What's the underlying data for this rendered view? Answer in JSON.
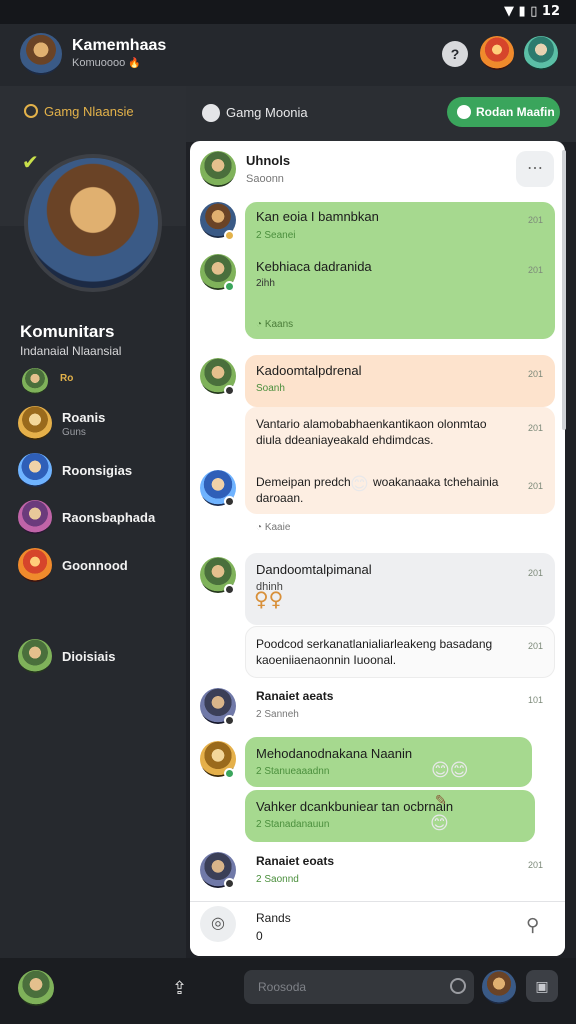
{
  "status_bar": {
    "time": "12",
    "icons": [
      "wifi-icon",
      "signal-icon",
      "battery-icon"
    ]
  },
  "header": {
    "title": "Kamemhaas",
    "subtitle": "Komuoooo",
    "subtitle_emoji": "🔥"
  },
  "sidebar": {
    "section_label": "Gamg Nlaansie",
    "hero_title": "Komunitars",
    "hero_subtitle": "Indanaial Nlaansial",
    "badge_label": "Ro",
    "items": [
      {
        "label": "Roanis",
        "sub": "Guns"
      },
      {
        "label": "Roonsigias",
        "sub": ""
      },
      {
        "label": "Raonsbaphada",
        "sub": ""
      },
      {
        "label": "Goonnood",
        "sub": ""
      },
      {
        "label": "Dioisiais",
        "sub": ""
      }
    ]
  },
  "panel": {
    "title": "Gamg Moonia",
    "action_button": "Rodan Maafin"
  },
  "chat": {
    "top": {
      "name": "Uhnols",
      "sub": "Saoonn"
    },
    "messages": [
      {
        "title": "Kan eoia I bamnbkan",
        "sub": "2 Seanei",
        "time": "201"
      },
      {
        "title": "Kebhiaca dadranida",
        "sub": "2ihh",
        "time": "201"
      },
      {
        "footer": "Kaans"
      },
      {
        "title": "Kadoomtalpdrenal",
        "sub": "Soanh",
        "time": "201"
      },
      {
        "line1": "Vantario alamobabhaenkantikaon olonmtao",
        "line2": "diula ddeaniayeakald ehdimdcas.",
        "time": "201"
      },
      {
        "line1": "Demeipan predch",
        "line1b": "woakanaaka tchehainia",
        "line2": "daroaan.",
        "time": "201"
      },
      {
        "footer": "Kaaie"
      },
      {
        "title": "Dandoomtalpimanal",
        "sub": "dhinh",
        "time": "201"
      },
      {
        "line1": "Poodcod serkanatlanialiarleakeng basadang",
        "line2": "kaoeniiaenaonnin Iuoonal.",
        "time": "201"
      },
      {
        "title": "Ranaiet aeats",
        "sub": "2 Sanneh",
        "time": "101"
      },
      {
        "title": "Mehodanodnakana Naanin",
        "sub": "2 Stanueaaadnn",
        "time": ""
      },
      {
        "title": "Vahker dcankbuniear tan ocbrnain",
        "sub": "2 Stanadanauun",
        "time": ""
      },
      {
        "title": "Ranaiet eoats",
        "sub": "2 Saonnd",
        "time": "201"
      }
    ],
    "compose": {
      "name": "Rands",
      "value": "0"
    }
  },
  "bottom": {
    "input_placeholder": "Roosoda"
  },
  "colors": {
    "accent": "#3aa55c",
    "bubble_green": "#a6d98f",
    "bubble_peach": "#fde3cd",
    "sidebar_bg": "#26292e"
  }
}
